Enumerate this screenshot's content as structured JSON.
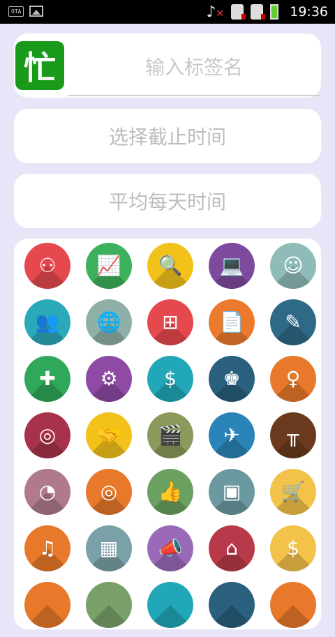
{
  "status_bar": {
    "left_icons": [
      "ota-icon",
      "image-icon"
    ],
    "ota_label": "OTA",
    "right_icons": [
      "music-muted-icon",
      "sim1-icon",
      "sim2-icon",
      "battery-icon"
    ],
    "time": "19:36"
  },
  "header": {
    "logo_char": "忙",
    "tag_placeholder": "输入标签名"
  },
  "buttons": {
    "deadline": "选择截止时间",
    "average": "平均每天时间"
  },
  "icon_grid": [
    {
      "name": "org-chart-icon",
      "color": "#e5484d",
      "glyph": "⚇"
    },
    {
      "name": "presentation-icon",
      "color": "#3cb05a",
      "glyph": "📈"
    },
    {
      "name": "user-search-icon",
      "color": "#f2c21b",
      "glyph": "🔍"
    },
    {
      "name": "video-call-icon",
      "color": "#7e4a9e",
      "glyph": "💻"
    },
    {
      "name": "support-agent-icon",
      "color": "#8fbcb8",
      "glyph": "☺"
    },
    {
      "name": "team-icon",
      "color": "#2aa9b8",
      "glyph": "👥"
    },
    {
      "name": "global-location-icon",
      "color": "#8fb0a8",
      "glyph": "🌐"
    },
    {
      "name": "hierarchy-icon",
      "color": "#e5484d",
      "glyph": "⊞"
    },
    {
      "name": "resume-icon",
      "color": "#ec7a2c",
      "glyph": "📄"
    },
    {
      "name": "document-edit-icon",
      "color": "#2e6a86",
      "glyph": "✎"
    },
    {
      "name": "puzzle-icon",
      "color": "#2fa85a",
      "glyph": "✚"
    },
    {
      "name": "gear-icon",
      "color": "#8e4aa5",
      "glyph": "⚙"
    },
    {
      "name": "dollar-icon",
      "color": "#22a7b8",
      "glyph": "$"
    },
    {
      "name": "winner-team-icon",
      "color": "#2a5f7e",
      "glyph": "♚"
    },
    {
      "name": "businesswoman-icon",
      "color": "#e8782a",
      "glyph": "♀"
    },
    {
      "name": "network-people-icon",
      "color": "#a8324a",
      "glyph": "◎"
    },
    {
      "name": "handshake-icon",
      "color": "#f2c21b",
      "glyph": "🤝"
    },
    {
      "name": "film-clapper-icon",
      "color": "#8a9a5a",
      "glyph": "🎬"
    },
    {
      "name": "airport-sign-icon",
      "color": "#2a84b8",
      "glyph": "✈"
    },
    {
      "name": "dining-table-icon",
      "color": "#6b3a1e",
      "glyph": "╥"
    },
    {
      "name": "pie-chart-icon",
      "color": "#b07a8a",
      "glyph": "◔"
    },
    {
      "name": "target-icon",
      "color": "#e8782a",
      "glyph": "◎"
    },
    {
      "name": "thumbs-up-icon",
      "color": "#6aa060",
      "glyph": "👍"
    },
    {
      "name": "package-icon",
      "color": "#6a9aa0",
      "glyph": "▣"
    },
    {
      "name": "shopping-cart-icon",
      "color": "#f2c24a",
      "glyph": "🛒"
    },
    {
      "name": "music-note-icon",
      "color": "#e8782a",
      "glyph": "♫"
    },
    {
      "name": "bar-blocks-icon",
      "color": "#7aa0a8",
      "glyph": "▦"
    },
    {
      "name": "megaphone-icon",
      "color": "#9a6ab8",
      "glyph": "📣"
    },
    {
      "name": "storefront-icon",
      "color": "#b83a4a",
      "glyph": "⌂"
    },
    {
      "name": "coin-icon",
      "color": "#f2c24a",
      "glyph": "$"
    },
    {
      "name": "partial-icon-1",
      "color": "#e8782a",
      "glyph": ""
    },
    {
      "name": "partial-icon-2",
      "color": "#7aa06a",
      "glyph": ""
    },
    {
      "name": "partial-icon-3",
      "color": "#22a7b8",
      "glyph": ""
    },
    {
      "name": "partial-icon-4",
      "color": "#2a5f7e",
      "glyph": ""
    },
    {
      "name": "partial-icon-5",
      "color": "#e8782a",
      "glyph": ""
    }
  ]
}
